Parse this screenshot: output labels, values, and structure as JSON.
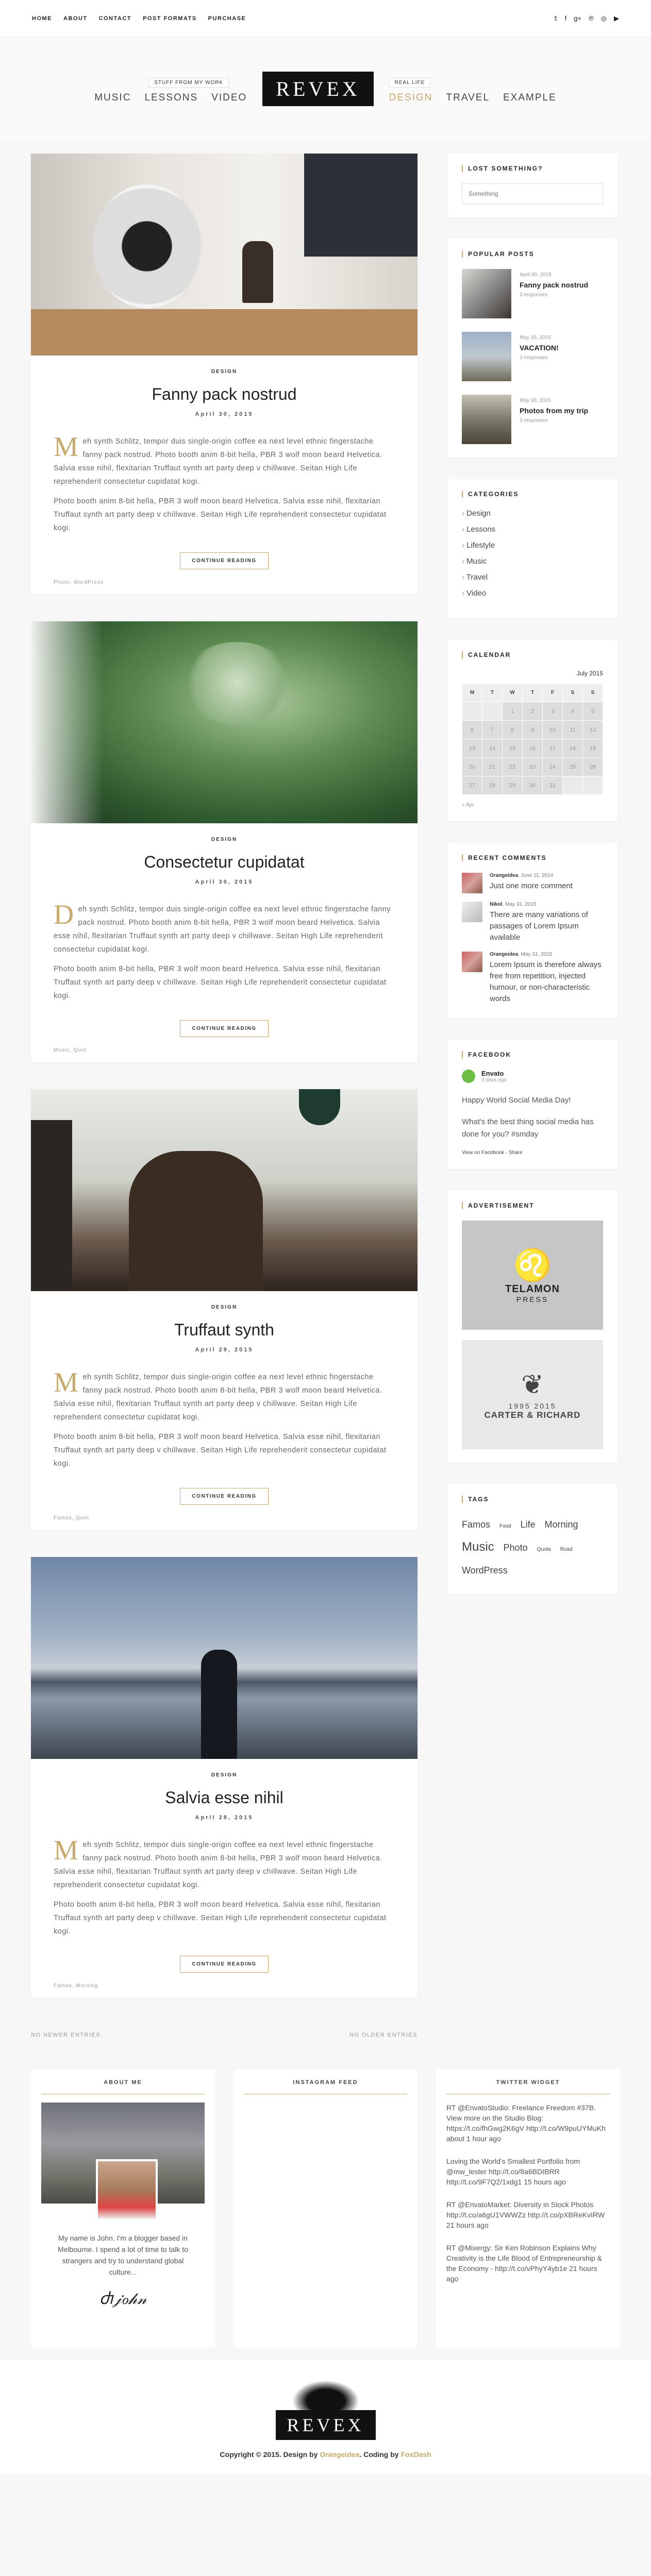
{
  "topnav": [
    "Home",
    "About",
    "Contact",
    "Post Formats",
    "Purchase"
  ],
  "social_icons": [
    "twitter-icon",
    "facebook-icon",
    "google-plus-icon",
    "pinterest-icon",
    "instagram-icon",
    "youtube-icon"
  ],
  "header": {
    "left_tag": "Stuff from my work",
    "left_items": [
      "Music",
      "Lessons",
      "Video"
    ],
    "logo": "REVEX",
    "right_tag": "Real life",
    "right_items": [
      "Design",
      "Travel",
      "Example"
    ],
    "active_item": "Design"
  },
  "posts": [
    {
      "category": "Design",
      "title": "Fanny pack nostrud",
      "date": "April 30, 2015",
      "dropcap": "M",
      "p1": "eh synth Schlitz, tempor duis single-origin coffee ea next level ethnic fingerstache fanny pack nostrud. Photo booth anim 8-bit hella, PBR 3 wolf moon beard Helvetica. Salvia esse nihil, flexitarian Truffaut synth art party deep v chillwave. Seitan High Life reprehenderit consectetur cupidatat kogi.",
      "p2": "Photo booth anim 8-bit hella, PBR 3 wolf moon beard Helvetica. Salvia esse nihil, flexitarian Truffaut synth art party deep v chillwave. Seitan High Life reprehenderit consectetur cupidatat kogi.",
      "button": "Continue reading",
      "tags": "Photo, WordPress"
    },
    {
      "category": "Design",
      "title": "Consectetur cupidatat",
      "date": "April 30, 2015",
      "dropcap": "D",
      "p1": "eh synth Schlitz, tempor duis single-origin coffee ea next level ethnic fingerstache fanny pack nostrud. Photo booth anim 8-bit hella, PBR 3 wolf moon beard Helvetica. Salvia esse nihil, flexitarian Truffaut synth art party deep v chillwave. Seitan High Life reprehenderit consectetur cupidatat kogi.",
      "p2": "Photo booth anim 8-bit hella, PBR 3 wolf moon beard Helvetica. Salvia esse nihil, flexitarian Truffaut synth art party deep v chillwave. Seitan High Life reprehenderit consectetur cupidatat kogi.",
      "button": "Continue reading",
      "tags": "Music, Quot"
    },
    {
      "category": "Design",
      "title": "Truffaut synth",
      "date": "April 29, 2015",
      "dropcap": "M",
      "p1": "eh synth Schlitz, tempor duis single-origin coffee ea next level ethnic fingerstache fanny pack nostrud. Photo booth anim 8-bit hella, PBR 3 wolf moon beard Helvetica. Salvia esse nihil, flexitarian Truffaut synth art party deep v chillwave. Seitan High Life reprehenderit consectetur cupidatat kogi.",
      "p2": "Photo booth anim 8-bit hella, PBR 3 wolf moon beard Helvetica. Salvia esse nihil, flexitarian Truffaut synth art party deep v chillwave. Seitan High Life reprehenderit consectetur cupidatat kogi.",
      "button": "Continue reading",
      "tags": "Famos, Quot"
    },
    {
      "category": "Design",
      "title": "Salvia esse nihil",
      "date": "April 28, 2015",
      "dropcap": "M",
      "p1": "eh synth Schlitz, tempor duis single-origin coffee ea next level ethnic fingerstache fanny pack nostrud. Photo booth anim 8-bit hella, PBR 3 wolf moon beard Helvetica. Salvia esse nihil, flexitarian Truffaut synth art party deep v chillwave. Seitan High Life reprehenderit consectetur cupidatat kogi.",
      "p2": "Photo booth anim 8-bit hella, PBR 3 wolf moon beard Helvetica. Salvia esse nihil, flexitarian Truffaut synth art party deep v chillwave. Seitan High Life reprehenderit consectetur cupidatat kogi.",
      "button": "Continue reading",
      "tags": "Famos, Morning"
    }
  ],
  "pager": {
    "newer": "No newer entries",
    "older": "No older entries"
  },
  "sidebar": {
    "search": {
      "title": "Lost Something?",
      "placeholder": "Something"
    },
    "popular": {
      "title": "Popular Posts",
      "items": [
        {
          "date": "April 30, 2015",
          "title": "Fanny pack nostrud",
          "responses": "3 responses"
        },
        {
          "date": "May 30, 2015",
          "title": "VACATION!",
          "responses": "3 responses"
        },
        {
          "date": "May 30, 2015",
          "title": "Photos from my trip",
          "responses": "3 responses"
        }
      ]
    },
    "categories": {
      "title": "Categories",
      "items": [
        "Design",
        "Lessons",
        "Lifestyle",
        "Music",
        "Travel",
        "Video"
      ]
    },
    "calendar": {
      "title": "Calendar",
      "month": "July 2015",
      "headers": [
        "M",
        "T",
        "W",
        "T",
        "F",
        "S",
        "S"
      ],
      "days": [
        "1",
        "2",
        "3",
        "4",
        "5",
        "6",
        "7",
        "8",
        "9",
        "10",
        "11",
        "12",
        "13",
        "14",
        "15",
        "16",
        "17",
        "18",
        "19",
        "20",
        "21",
        "22",
        "23",
        "24",
        "25",
        "26",
        "27",
        "28",
        "29",
        "30",
        "31"
      ],
      "prev": "« Apr"
    },
    "comments": {
      "title": "Recent Comments",
      "items": [
        {
          "author": "Orangeidea",
          "date": "June 11, 2014",
          "text": "Just one more comment"
        },
        {
          "author": "Nikol",
          "date": "May 31, 2015",
          "text": "There are many variations of passages of Lorem Ipsum available"
        },
        {
          "author": "Orangeidea",
          "date": "May 31, 2015",
          "text": "Lorem Ipsum is therefore always free from repetition, injected humour, or non-characteristic words"
        }
      ]
    },
    "facebook": {
      "title": "Facebook",
      "name": "Envato",
      "time": "3 days ago",
      "text1": "Happy World Social Media Day!",
      "text2": "What's the best thing social media has done for you? #smday",
      "view": "View on Facebook",
      "share": "Share"
    },
    "advertisement": {
      "title": "Advertisement",
      "ad1_big": "Telamon",
      "ad1_small": "Press",
      "ad2_big": "Carter & Richard",
      "ad2_years": "1995  2015"
    },
    "tags": {
      "title": "Tags",
      "items": [
        {
          "name": "Famos",
          "size": 18
        },
        {
          "name": "Food",
          "size": 10
        },
        {
          "name": "Life",
          "size": 18
        },
        {
          "name": "Morning",
          "size": 18
        },
        {
          "name": "Music",
          "size": 24
        },
        {
          "name": "Photo",
          "size": 18
        },
        {
          "name": "Quota",
          "size": 10
        },
        {
          "name": "Road",
          "size": 10
        },
        {
          "name": "WordPress",
          "size": 18
        }
      ]
    }
  },
  "footer": {
    "about": {
      "title": "About me",
      "text": "My name is John. I'm a blogger based in Melbourne. I spend a lot of time to talk to strangers and try to understand global culture...",
      "signature": "Signature"
    },
    "instagram": {
      "title": "Instagram Feed"
    },
    "twitter": {
      "title": "Twitter Widget",
      "tweets": [
        "RT @EnvatoStudio: Freelance Freedom #37B. View more on the Studio Blog: https://t.co/fhGwg2K6gV http://t.co/W9puUYMuKh about 1 hour ago",
        "Loving the World's Smallest Portfolio from @mw_lester http://t.co/8a6BDIBRR http://t.co/9F7Q2/1xdg1 15 hours ago",
        "RT @EnvatoMarket: Diversity in Stock Photos http://t.co/a6gU1VWWZz http://t.co/pXBReKvIRW 21 hours ago",
        "RT @Mixergy: Sir Ken Robinson Explains Why Creativity is the Life Blood of Entrepreneurship & the Economy - http://t.co/vPhyY4yb1e 21 hours ago"
      ]
    }
  },
  "bottom": {
    "logo": "REVEX",
    "copyright_prefix": "Copyright © 2015. Design by ",
    "designer": "Orangeidea",
    "coding_prefix": ". Coding by ",
    "coder": "FoxDash"
  }
}
